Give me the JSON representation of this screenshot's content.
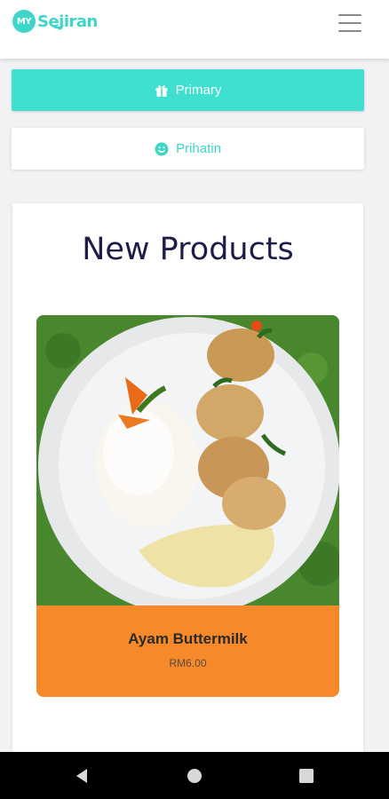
{
  "header": {
    "logo_badge": "MY",
    "logo_word": "Sejiran",
    "menu_icon": "hamburger-menu-icon"
  },
  "buttons": {
    "primary_label": "Primary",
    "primary_icon": "gift-icon",
    "prihatin_label": "Prihatin",
    "prihatin_icon": "smile-icon"
  },
  "section": {
    "title": "New Products"
  },
  "products": [
    {
      "name": "Ayam Buttermilk",
      "price": "RM6.00",
      "image": "food-photo-rice-buttermilk-chicken"
    }
  ],
  "colors": {
    "accent": "#3fe0cf",
    "product_card": "#f6892a",
    "title": "#1d1d4a"
  },
  "system_nav": {
    "back_icon": "back-triangle-icon",
    "home_icon": "home-circle-icon",
    "recent_icon": "recent-apps-square-icon"
  }
}
